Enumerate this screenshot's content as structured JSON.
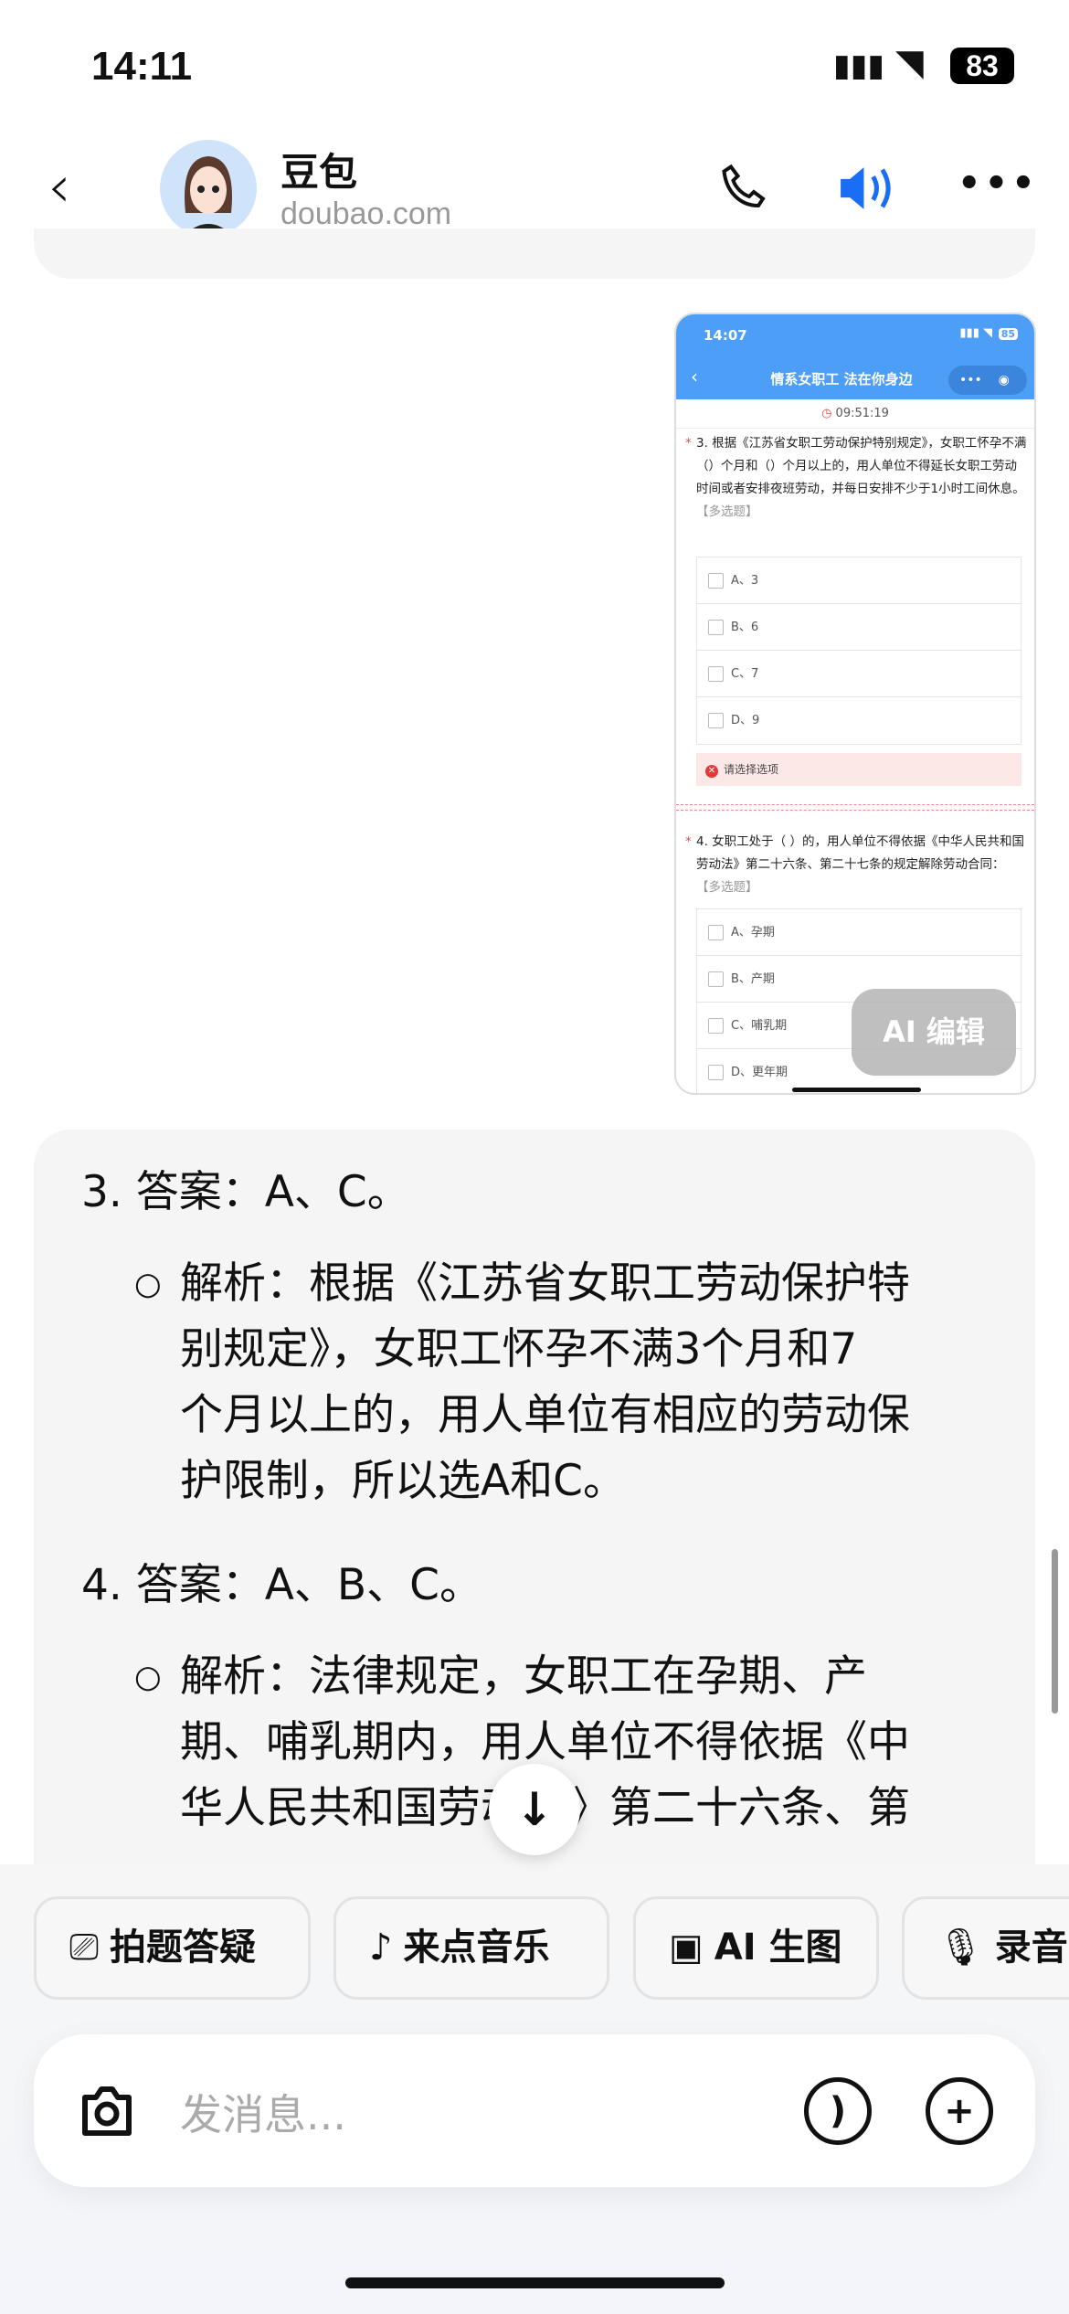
{
  "status_bar": {
    "time": "14:11",
    "battery": "83",
    "signal_icon": "signal-icon",
    "wifi_icon": "wifi-icon"
  },
  "header": {
    "title": "豆包",
    "subtitle": "doubao.com",
    "back_icon": "chevron-left-icon",
    "call_icon": "phone-icon",
    "speaker_icon": "speaker-icon",
    "more_icon": "more-icon",
    "accent": "#1a6ef5"
  },
  "attachment": {
    "status_time": "14:07",
    "battery": "85",
    "nav_title": "情系女职工 法在你身边",
    "timer": "09:51:19",
    "q3": {
      "text": "3. 根据《江苏省女职工劳动保护特别规定》，女职工怀孕不满（）个月和（）个月以上的，用人单位不得延长女职工劳动时间或者安排夜班劳动，并每日安排不少于1小时工间休息。",
      "tag": "【多选题】",
      "options": [
        "A、3",
        "B、6",
        "C、7",
        "D、9"
      ],
      "error": "请选择选项"
    },
    "q4": {
      "text": "4. 女职工处于（ ）的，用人单位不得依据《中华人民共和国劳动法》第二十六条、第二十七条的规定解除劳动合同：",
      "tag": "【多选题】",
      "options": [
        "A、孕期",
        "B、产期",
        "C、哺乳期",
        "D、更年期"
      ]
    },
    "overlay": "AI 编辑",
    "header_color": "#4d9ef6"
  },
  "answer": {
    "a3": "3. 答案：A、C。",
    "a3_lines": [
      "解析：根据《江苏省女职工劳动保护特",
      "别规定》，女职工怀孕不满3个月和7",
      "个月以上的，用人单位有相应的劳动保",
      "护限制，所以选A和C。"
    ],
    "a4": "4. 答案：A、B、C。",
    "a4_lines": [
      "解析：法律规定，女职工在孕期、产",
      "期、哺乳期内，用人单位不得依据《中",
      "华人民共和国劳动法》第二十六条、第"
    ]
  },
  "chips": [
    {
      "label": "拍题答疑",
      "icon": "photo-search-icon"
    },
    {
      "label": "来点音乐",
      "icon": "music-icon"
    },
    {
      "label": "AI 生图",
      "icon": "image-icon"
    },
    {
      "label": "录音",
      "icon": "mic-icon"
    }
  ],
  "input": {
    "placeholder": "发消息..."
  }
}
